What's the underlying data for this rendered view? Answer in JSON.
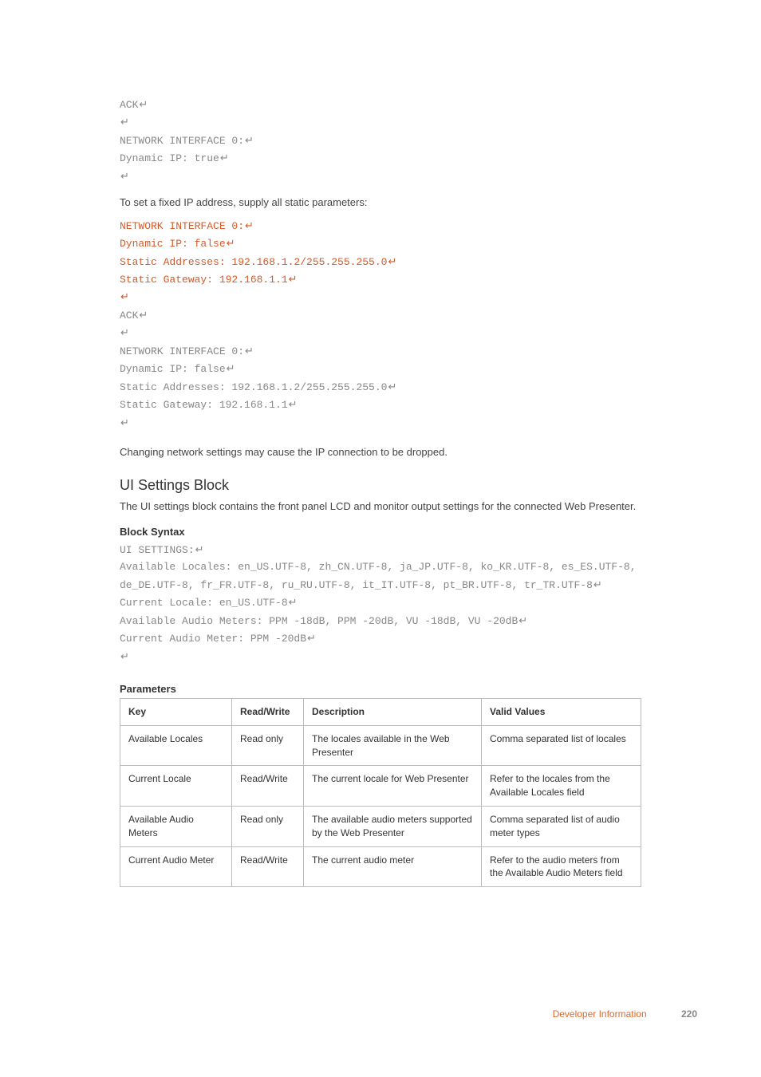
{
  "code_block_1": [
    {
      "text": "ACK",
      "ret": true
    },
    {
      "text": "",
      "ret": true
    },
    {
      "text": "NETWORK INTERFACE 0:",
      "ret": true
    },
    {
      "text": "Dynamic IP: true",
      "ret": true
    },
    {
      "text": "",
      "ret": true
    }
  ],
  "para_1": "To set a fixed IP address, supply all static parameters:",
  "code_block_2_red": [
    {
      "text": "NETWORK INTERFACE 0:",
      "ret": true
    },
    {
      "text": "Dynamic IP: false",
      "ret": true
    },
    {
      "text": "Static Addresses: 192.168.1.2/255.255.255.0",
      "ret": true
    },
    {
      "text": "Static Gateway: 192.168.1.1",
      "ret": true
    },
    {
      "text": "",
      "ret": true
    }
  ],
  "code_block_2_grey": [
    {
      "text": "ACK",
      "ret": true
    },
    {
      "text": "",
      "ret": true
    },
    {
      "text": "NETWORK INTERFACE 0:",
      "ret": true
    },
    {
      "text": "Dynamic IP: false",
      "ret": true
    },
    {
      "text": "Static Addresses: 192.168.1.2/255.255.255.0",
      "ret": true
    },
    {
      "text": "Static Gateway: 192.168.1.1",
      "ret": true
    },
    {
      "text": "",
      "ret": true
    }
  ],
  "para_2": "Changing network settings may cause the IP connection to be dropped.",
  "heading_ui": "UI Settings Block",
  "para_3": "The UI settings block contains the front panel LCD and monitor output settings for the connected Web Presenter.",
  "block_syntax_label": "Block Syntax",
  "code_block_3": [
    {
      "text": "UI SETTINGS:",
      "ret": true
    },
    {
      "text": "Available Locales: en_US.UTF-8, zh_CN.UTF-8, ja_JP.UTF-8, ko_KR.UTF-8, es_ES.UTF-8, de_DE.UTF-8, fr_FR.UTF-8, ru_RU.UTF-8, it_IT.UTF-8, pt_BR.UTF-8, tr_TR.UTF-8",
      "ret": true
    },
    {
      "text": "Current Locale: en_US.UTF-8",
      "ret": true
    },
    {
      "text": "Available Audio Meters: PPM -18dB, PPM -20dB, VU -18dB, VU -20dB",
      "ret": true
    },
    {
      "text": "Current Audio Meter: PPM -20dB",
      "ret": true
    },
    {
      "text": "",
      "ret": true
    }
  ],
  "parameters_label": "Parameters",
  "table": {
    "headers": [
      "Key",
      "Read/Write",
      "Description",
      "Valid Values"
    ],
    "rows": [
      [
        "Available Locales",
        "Read only",
        "The locales available in the Web Presenter",
        "Comma separated list of locales"
      ],
      [
        "Current Locale",
        "Read/Write",
        "The current locale for Web Presenter",
        "Refer to the locales from the Available Locales field"
      ],
      [
        "Available Audio Meters",
        "Read only",
        "The available audio meters supported by the Web Presenter",
        "Comma separated list of audio meter types"
      ],
      [
        "Current Audio Meter",
        "Read/Write",
        "The current audio meter",
        "Refer to the audio meters from the Available Audio Meters field"
      ]
    ]
  },
  "footer": {
    "section": "Developer Information",
    "page": "220"
  },
  "return_glyph": "↵"
}
